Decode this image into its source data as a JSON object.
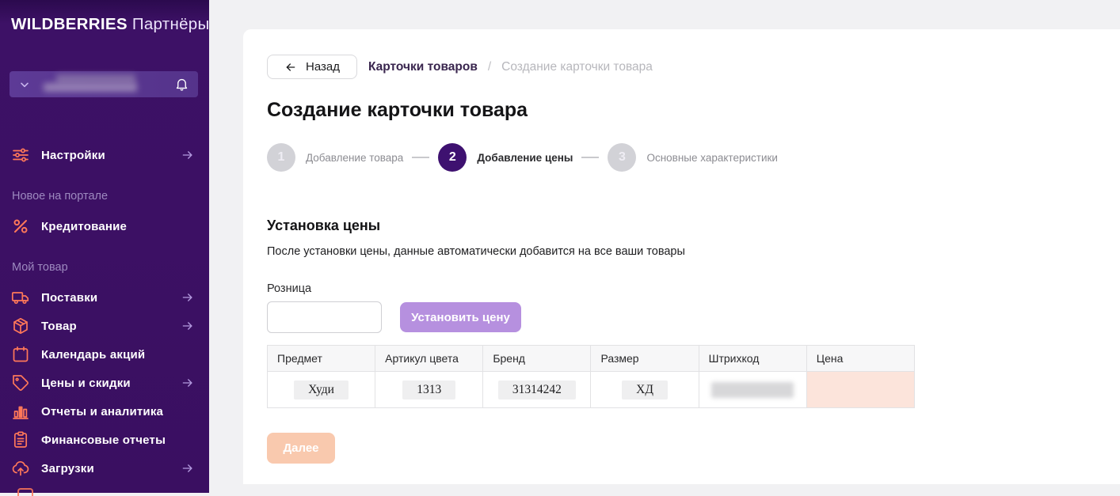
{
  "sidebar": {
    "logo_brand": "WILDBERRIES",
    "logo_suffix": "Партнёры",
    "user_box": {
      "name_redacted": true,
      "icons": [
        "chevron-down-icon",
        "bell-icon"
      ]
    },
    "menu": [
      {
        "type": "item",
        "label": "Настройки",
        "icon": "sliders-icon",
        "arrow": true
      },
      {
        "type": "section",
        "label": "Новое на портале"
      },
      {
        "type": "item",
        "label": "Кредитование",
        "icon": "percent-icon",
        "arrow": false
      },
      {
        "type": "section",
        "label": "Мой товар"
      },
      {
        "type": "item",
        "label": "Поставки",
        "icon": "truck-icon",
        "arrow": true
      },
      {
        "type": "item",
        "label": "Товар",
        "icon": "box-icon",
        "arrow": true
      },
      {
        "type": "item",
        "label": "Календарь акций",
        "icon": "calendar-icon",
        "arrow": false
      },
      {
        "type": "item",
        "label": "Цены и скидки",
        "icon": "tag-icon",
        "arrow": true
      },
      {
        "type": "item",
        "label": "Отчеты и аналитика",
        "icon": "bar-chart-icon",
        "arrow": false
      },
      {
        "type": "item",
        "label": "Финансовые отчеты",
        "icon": "clipboard-icon",
        "arrow": false
      },
      {
        "type": "item",
        "label": "Загрузки",
        "icon": "cloud-upload-icon",
        "arrow": true
      }
    ]
  },
  "header": {
    "back_label": "Назад",
    "breadcrumb_separator": "/",
    "breadcrumb": [
      {
        "label": "Карточки товаров",
        "current": false
      },
      {
        "label": "Создание карточки товара",
        "current": true
      }
    ],
    "title": "Создание карточки товара"
  },
  "stepper": {
    "steps": [
      {
        "number": "1",
        "label": "Добавление товара",
        "active": false
      },
      {
        "number": "2",
        "label": "Добавление цены",
        "active": true
      },
      {
        "number": "3",
        "label": "Основные характеристики",
        "active": false
      }
    ]
  },
  "price_section": {
    "heading": "Установка цены",
    "description": "После установки цены, данные автоматически добавится на все ваши товары",
    "retail_label": "Розница",
    "retail_value": "",
    "set_price_button": "Установить цену"
  },
  "table": {
    "columns": [
      "Предмет",
      "Артикул цвета",
      "Бренд",
      "Размер",
      "Штрихкод",
      "Цена"
    ],
    "rows": [
      {
        "cells": [
          {
            "text": "Худи"
          },
          {
            "text": "1313"
          },
          {
            "text": "31314242"
          },
          {
            "text": "ХД"
          },
          {
            "redacted": true
          },
          {
            "text": "",
            "state": "error"
          }
        ]
      }
    ]
  },
  "next_button": "Далее",
  "colors": {
    "sidebar_bg": "#3A0F61",
    "sidebar_icon_accent": "#FF7859",
    "active_step": "#3E1170",
    "set_price_button_bg": "#B690DF",
    "next_button_bg": "#F9C9AE",
    "error_cell_bg": "#FCE4DB"
  }
}
